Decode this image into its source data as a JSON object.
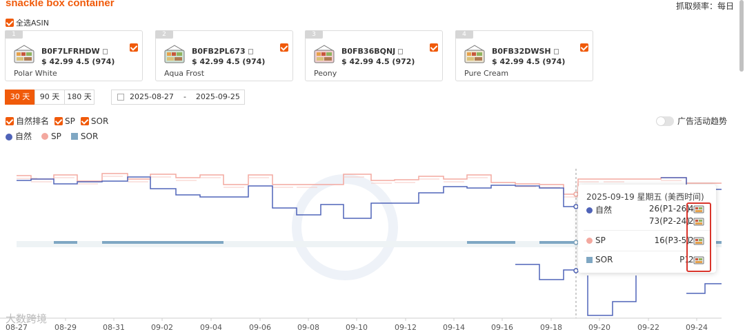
{
  "header": {
    "title": "snackle box container",
    "frequency": "抓取频率：每日"
  },
  "select_all_label": "全选ASIN",
  "products": [
    {
      "num": "1",
      "asin": "B0F7LFRHDW",
      "price": "$ 42.99 4.5 (974)",
      "name": "Polar White",
      "thumb_color": "#e9e9e9"
    },
    {
      "num": "2",
      "asin": "B0FB2PL673",
      "price": "$ 42.99 4.5 (974)",
      "name": "Aqua Frost",
      "thumb_color": "#cfe3d6"
    },
    {
      "num": "3",
      "asin": "B0FB36BQNJ",
      "price": "$ 42.99 4.5 (972)",
      "name": "Peony",
      "thumb_color": "#f1cfd0"
    },
    {
      "num": "4",
      "asin": "B0FB32DWSH",
      "price": "$ 42.99 4.5 (974)",
      "name": "Pure Cream",
      "thumb_color": "#eee6d3"
    }
  ],
  "range_buttons": [
    "30 天",
    "90 天",
    "180 天"
  ],
  "date_range": {
    "start": "2025-08-27",
    "sep": "-",
    "end": "2025-09-25"
  },
  "toggles": [
    "自然排名",
    "SP",
    "SOR"
  ],
  "ad_toggle_label": "广告活动趋势",
  "legend": [
    {
      "name": "自然",
      "color": "#4f63b8"
    },
    {
      "name": "SP",
      "color": "#f3a89f"
    },
    {
      "name": "SOR",
      "color": "#7fa7c3"
    }
  ],
  "tooltip": {
    "date": "2025-09-19 星期五 (美西时间)",
    "rows": [
      {
        "label": "自然",
        "values": [
          "26(P1-26)",
          "73(P2-24)"
        ],
        "tail": [
          "4",
          "2"
        ],
        "color": "#4f63b8",
        "shape": "dot"
      },
      {
        "label": "SP",
        "values": [
          "16(P3-5)"
        ],
        "tail": [
          "2"
        ],
        "color": "#f3a89f",
        "shape": "dot"
      },
      {
        "label": "SOR",
        "values": [
          "P1"
        ],
        "tail": [
          "2"
        ],
        "color": "#7fa7c3",
        "shape": "square"
      }
    ]
  },
  "watermark": "大数跨境",
  "chart_data": {
    "type": "line",
    "x": [
      "08-27",
      "08-29",
      "08-31",
      "09-02",
      "09-04",
      "09-06",
      "09-08",
      "09-10",
      "09-12",
      "09-14",
      "09-16",
      "09-18",
      "09-20",
      "09-22",
      "09-24"
    ],
    "series": [
      {
        "name": "自然",
        "color": "#4f63b8"
      },
      {
        "name": "SP",
        "color": "#f3a89f"
      },
      {
        "name": "SOR",
        "color": "#7fa7c3"
      }
    ]
  }
}
